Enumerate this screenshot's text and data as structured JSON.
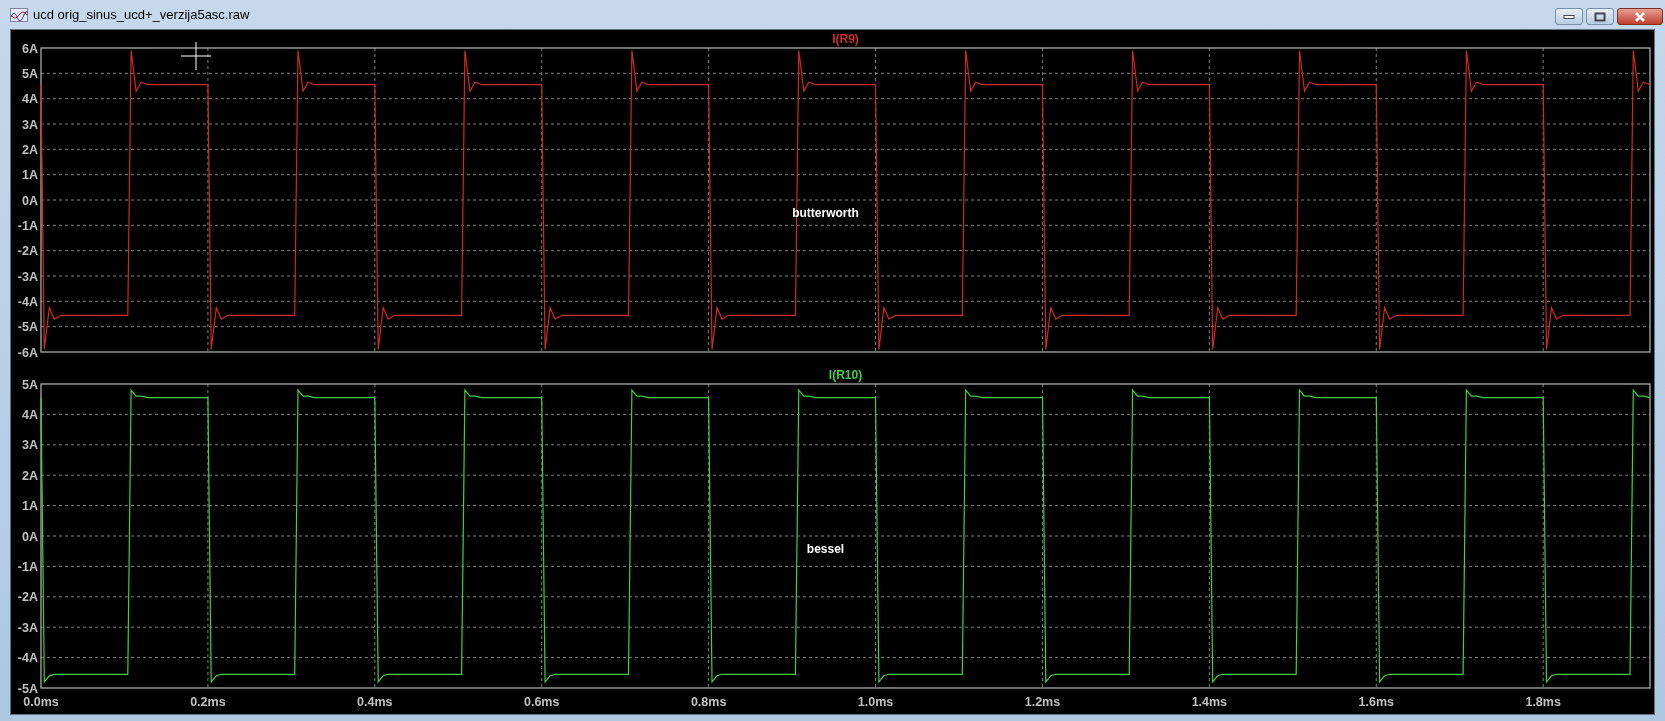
{
  "window": {
    "title": "ucd orig_sinus_ucd+_verzija5asc.raw"
  },
  "panes": [
    {
      "chart_data": {
        "type": "line",
        "x": [
          0,
          0.004,
          0.01,
          0.016,
          0.024,
          0.104,
          0.108,
          0.114,
          0.12,
          0.128,
          0.2,
          0.204,
          0.21,
          0.216,
          0.224,
          0.304,
          0.308,
          0.314,
          0.32,
          0.328,
          0.4,
          0.404,
          0.41,
          0.416,
          0.424,
          0.504,
          0.508,
          0.514,
          0.52,
          0.528,
          0.6,
          0.604,
          0.61,
          0.616,
          0.624,
          0.704,
          0.708,
          0.714,
          0.72,
          0.728,
          0.8,
          0.804,
          0.81,
          0.816,
          0.824,
          0.904,
          0.908,
          0.914,
          0.92,
          0.928,
          1.0,
          1.004,
          1.01,
          1.016,
          1.024,
          1.104,
          1.108,
          1.114,
          1.12,
          1.128,
          1.2,
          1.204,
          1.21,
          1.216,
          1.224,
          1.304,
          1.308,
          1.314,
          1.32,
          1.328,
          1.4,
          1.404,
          1.41,
          1.416,
          1.424,
          1.504,
          1.508,
          1.514,
          1.52,
          1.528,
          1.6,
          1.604,
          1.61,
          1.616,
          1.624,
          1.704,
          1.708,
          1.714,
          1.72,
          1.728,
          1.8,
          1.804,
          1.81,
          1.816,
          1.824,
          1.904,
          1.908,
          1.914,
          1.92,
          1.928
        ],
        "series": [
          {
            "name": "I(R9)",
            "color": "#d02828",
            "values": [
              4.55,
              -5.9,
              -4.25,
              -4.7,
              -4.55,
              -4.55,
              5.9,
              4.3,
              4.65,
              4.55,
              4.55,
              -5.9,
              -4.25,
              -4.7,
              -4.55,
              -4.55,
              5.9,
              4.3,
              4.65,
              4.55,
              4.55,
              -5.9,
              -4.25,
              -4.7,
              -4.55,
              -4.55,
              5.9,
              4.3,
              4.65,
              4.55,
              4.55,
              -5.9,
              -4.25,
              -4.7,
              -4.55,
              -4.55,
              5.9,
              4.3,
              4.65,
              4.55,
              4.55,
              -5.9,
              -4.25,
              -4.7,
              -4.55,
              -4.55,
              5.9,
              4.3,
              4.65,
              4.55,
              4.55,
              -5.9,
              -4.25,
              -4.7,
              -4.55,
              -4.55,
              5.9,
              4.3,
              4.65,
              4.55,
              4.55,
              -5.9,
              -4.25,
              -4.7,
              -4.55,
              -4.55,
              5.9,
              4.3,
              4.65,
              4.55,
              4.55,
              -5.9,
              -4.25,
              -4.7,
              -4.55,
              -4.55,
              5.9,
              4.3,
              4.65,
              4.55,
              4.55,
              -5.9,
              -4.25,
              -4.7,
              -4.55,
              -4.55,
              5.9,
              4.3,
              4.65,
              4.55,
              4.55,
              -5.9,
              -4.25,
              -4.7,
              -4.55,
              -4.55,
              5.9,
              4.3,
              4.65,
              4.55
            ]
          }
        ],
        "xlim": [
          0,
          1.928
        ],
        "ylim": [
          -6,
          6
        ],
        "grid": true,
        "yticks": [
          {
            "value": 6,
            "label": "6A"
          },
          {
            "value": 5,
            "label": "5A"
          },
          {
            "value": 4,
            "label": "4A"
          },
          {
            "value": 3,
            "label": "3A"
          },
          {
            "value": 2,
            "label": "2A"
          },
          {
            "value": 1,
            "label": "1A"
          },
          {
            "value": 0,
            "label": "0A"
          },
          {
            "value": -1,
            "label": "-1A"
          },
          {
            "value": -2,
            "label": "-2A"
          },
          {
            "value": -3,
            "label": "-3A"
          },
          {
            "value": -4,
            "label": "-4A"
          },
          {
            "value": -5,
            "label": "-5A"
          },
          {
            "value": -6,
            "label": "-6A"
          }
        ],
        "annotations": [
          {
            "text": "butterworth"
          }
        ]
      }
    },
    {
      "chart_data": {
        "type": "line",
        "x": [
          0,
          0.004,
          0.01,
          0.016,
          0.024,
          0.104,
          0.108,
          0.114,
          0.12,
          0.128,
          0.2,
          0.204,
          0.21,
          0.216,
          0.224,
          0.304,
          0.308,
          0.314,
          0.32,
          0.328,
          0.4,
          0.404,
          0.41,
          0.416,
          0.424,
          0.504,
          0.508,
          0.514,
          0.52,
          0.528,
          0.6,
          0.604,
          0.61,
          0.616,
          0.624,
          0.704,
          0.708,
          0.714,
          0.72,
          0.728,
          0.8,
          0.804,
          0.81,
          0.816,
          0.824,
          0.904,
          0.908,
          0.914,
          0.92,
          0.928,
          1.0,
          1.004,
          1.01,
          1.016,
          1.024,
          1.104,
          1.108,
          1.114,
          1.12,
          1.128,
          1.2,
          1.204,
          1.21,
          1.216,
          1.224,
          1.304,
          1.308,
          1.314,
          1.32,
          1.328,
          1.4,
          1.404,
          1.41,
          1.416,
          1.424,
          1.504,
          1.508,
          1.514,
          1.52,
          1.528,
          1.6,
          1.604,
          1.61,
          1.616,
          1.624,
          1.704,
          1.708,
          1.714,
          1.72,
          1.728,
          1.8,
          1.804,
          1.81,
          1.816,
          1.824,
          1.904,
          1.908,
          1.914,
          1.92,
          1.928
        ],
        "series": [
          {
            "name": "I(R10)",
            "color": "#40d040",
            "values": [
              4.55,
              -4.8,
              -4.6,
              -4.55,
              -4.55,
              -4.55,
              4.8,
              4.6,
              4.6,
              4.55,
              4.55,
              -4.8,
              -4.6,
              -4.55,
              -4.55,
              -4.55,
              4.8,
              4.6,
              4.6,
              4.55,
              4.55,
              -4.8,
              -4.6,
              -4.55,
              -4.55,
              -4.55,
              4.8,
              4.6,
              4.6,
              4.55,
              4.55,
              -4.8,
              -4.6,
              -4.55,
              -4.55,
              -4.55,
              4.8,
              4.6,
              4.6,
              4.55,
              4.55,
              -4.8,
              -4.6,
              -4.55,
              -4.55,
              -4.55,
              4.8,
              4.6,
              4.6,
              4.55,
              4.55,
              -4.8,
              -4.6,
              -4.55,
              -4.55,
              -4.55,
              4.8,
              4.6,
              4.6,
              4.55,
              4.55,
              -4.8,
              -4.6,
              -4.55,
              -4.55,
              -4.55,
              4.8,
              4.6,
              4.6,
              4.55,
              4.55,
              -4.8,
              -4.6,
              -4.55,
              -4.55,
              -4.55,
              4.8,
              4.6,
              4.6,
              4.55,
              4.55,
              -4.8,
              -4.6,
              -4.55,
              -4.55,
              -4.55,
              4.8,
              4.6,
              4.6,
              4.55,
              4.55,
              -4.8,
              -4.6,
              -4.55,
              -4.55,
              -4.55,
              4.8,
              4.6,
              4.6,
              4.55
            ]
          }
        ],
        "xlim": [
          0,
          1.928
        ],
        "ylim": [
          -5,
          5
        ],
        "grid": true,
        "xticks": [
          {
            "value": 0,
            "label": "0.0ms"
          },
          {
            "value": 0.2,
            "label": "0.2ms"
          },
          {
            "value": 0.4,
            "label": "0.4ms"
          },
          {
            "value": 0.6,
            "label": "0.6ms"
          },
          {
            "value": 0.8,
            "label": "0.8ms"
          },
          {
            "value": 1.0,
            "label": "1.0ms"
          },
          {
            "value": 1.2,
            "label": "1.2ms"
          },
          {
            "value": 1.4,
            "label": "1.4ms"
          },
          {
            "value": 1.6,
            "label": "1.6ms"
          },
          {
            "value": 1.8,
            "label": "1.8ms"
          }
        ],
        "yticks": [
          {
            "value": 5,
            "label": "5A"
          },
          {
            "value": 4,
            "label": "4A"
          },
          {
            "value": 3,
            "label": "3A"
          },
          {
            "value": 2,
            "label": "2A"
          },
          {
            "value": 1,
            "label": "1A"
          },
          {
            "value": 0,
            "label": "0A"
          },
          {
            "value": -1,
            "label": "-1A"
          },
          {
            "value": -2,
            "label": "-2A"
          },
          {
            "value": -3,
            "label": "-3A"
          },
          {
            "value": -4,
            "label": "-4A"
          },
          {
            "value": -5,
            "label": "-5A"
          }
        ],
        "annotations": [
          {
            "text": "bessel"
          }
        ]
      }
    }
  ]
}
